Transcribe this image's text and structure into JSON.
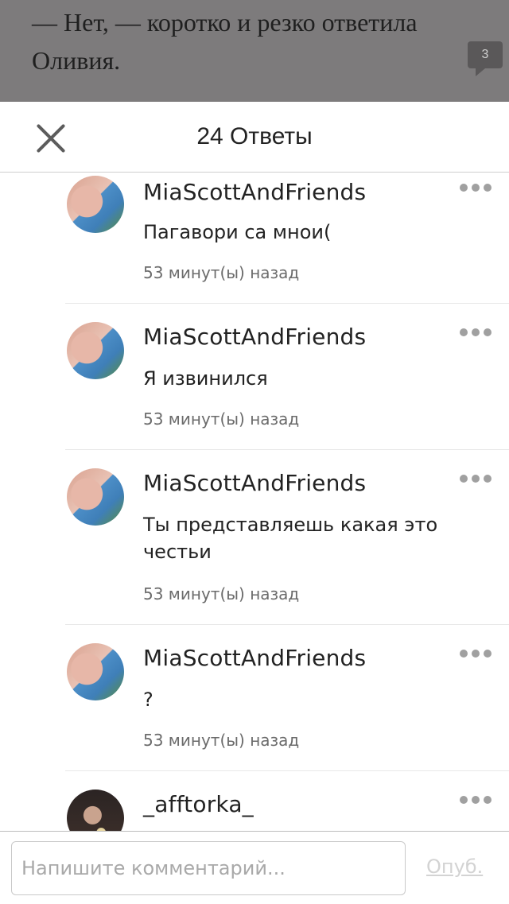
{
  "story": {
    "lines": [
      "— Нет, — коротко и резко ответила",
      "Оливия."
    ],
    "comment_count": "3"
  },
  "sheet": {
    "title": "24 Ответы"
  },
  "comments": [
    {
      "author": "MiaScottAndFriends",
      "text": "Пагавори са мнои(",
      "time": "53 минут(ы) назад"
    },
    {
      "author": "MiaScottAndFriends",
      "text": "Я извинился",
      "time": "53 минут(ы) назад"
    },
    {
      "author": "MiaScottAndFriends",
      "text": "Ты представляешь какая это честьи",
      "time": "53 минут(ы) назад"
    },
    {
      "author": "MiaScottAndFriends",
      "text": "?",
      "time": "53 минут(ы) назад"
    },
    {
      "author": "_afftorka_"
    }
  ],
  "composer": {
    "placeholder": "Напишите комментарий...",
    "publish_label": "Опуб."
  }
}
